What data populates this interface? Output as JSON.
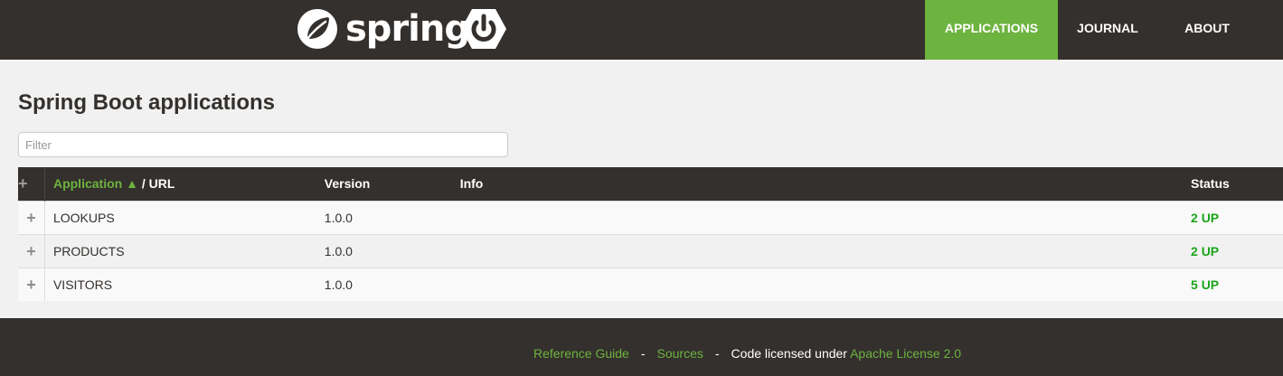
{
  "header": {
    "brand_text": "spring",
    "nav": [
      "APPLICATIONS",
      "JOURNAL",
      "ABOUT"
    ],
    "active_nav": "APPLICATIONS"
  },
  "main": {
    "title": "Spring Boot applications",
    "filter_placeholder": "Filter",
    "table": {
      "header_plus": "+",
      "columns": {
        "application": "Application ▲",
        "url": " / URL",
        "version": "Version",
        "info": "Info",
        "status": "Status"
      },
      "rows": [
        {
          "plus": "+",
          "application": "LOOKUPS",
          "version": "1.0.0",
          "info": "",
          "status": "2 UP"
        },
        {
          "plus": "+",
          "application": "PRODUCTS",
          "version": "1.0.0",
          "info": "",
          "status": "2 UP"
        },
        {
          "plus": "+",
          "application": "VISITORS",
          "version": "1.0.0",
          "info": "",
          "status": "5 UP"
        }
      ]
    }
  },
  "footer": {
    "reference_guide": "Reference Guide",
    "separator": "-",
    "sources": "Sources",
    "license_prefix": "Code licensed under",
    "license_link": "Apache License 2.0"
  },
  "colors": {
    "dark": "#34302d",
    "accent_green": "#6db33f",
    "status_up": "#1aa51a"
  },
  "icons": [
    "spring-leaf-icon",
    "spring-boot-power-icon",
    "plus-icon"
  ]
}
